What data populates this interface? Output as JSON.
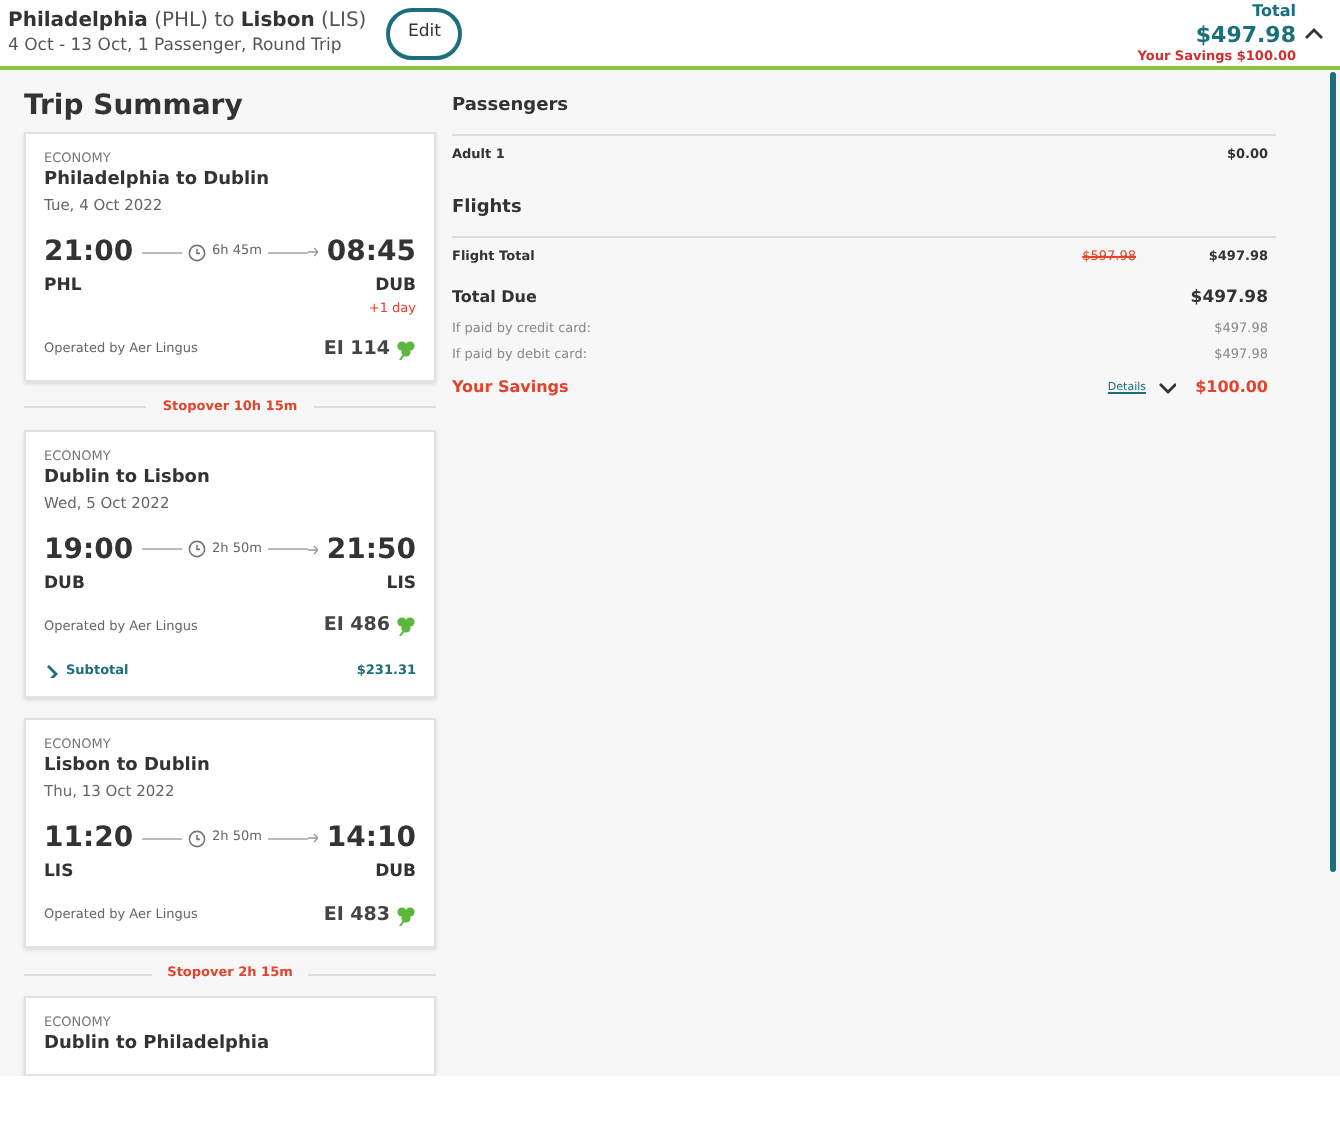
{
  "header": {
    "origin": "Philadelphia",
    "origin_code": "(PHL)",
    "connector": "to",
    "destination": "Lisbon",
    "destination_code": "(LIS)",
    "details": "4 Oct - 13 Oct, 1 Passenger, Round Trip",
    "edit_button": "Edit",
    "total_label": "Total",
    "total": "$497.98",
    "savings": "Your Savings $100.00",
    "expanded": true
  },
  "trip_summary": {
    "title": "Trip Summary",
    "items": [
      {
        "kind": "segment",
        "cabin": "ECONOMY",
        "route": "Philadelphia to Dublin",
        "date": "Tue, 4 Oct 2022",
        "depart_time": "21:00",
        "duration": "6h 45m",
        "arrive_time": "08:45",
        "depart_code": "PHL",
        "arrive_code": "DUB",
        "day_offset": "+1 day",
        "operator": "Operated by Aer Lingus",
        "flight": "EI 114"
      },
      {
        "kind": "stopover",
        "label": "Stopover 10h 15m"
      },
      {
        "kind": "segment",
        "cabin": "ECONOMY",
        "route": "Dublin to Lisbon",
        "date": "Wed, 5 Oct 2022",
        "depart_time": "19:00",
        "duration": "2h 50m",
        "arrive_time": "21:50",
        "depart_code": "DUB",
        "arrive_code": "LIS",
        "operator": "Operated by Aer Lingus",
        "flight": "EI 486",
        "subtotal": {
          "label": "Subtotal",
          "amount": "$231.31",
          "expanded": false
        }
      },
      {
        "kind": "segment",
        "cabin": "ECONOMY",
        "route": "Lisbon to Dublin",
        "date": "Thu, 13 Oct 2022",
        "depart_time": "11:20",
        "duration": "2h 50m",
        "arrive_time": "14:10",
        "depart_code": "LIS",
        "arrive_code": "DUB",
        "operator": "Operated by Aer Lingus",
        "flight": "EI 483"
      },
      {
        "kind": "stopover",
        "label": "Stopover 2h 15m"
      },
      {
        "kind": "segment",
        "cabin": "ECONOMY",
        "route": "Dublin to Philadelphia"
      }
    ]
  },
  "price_summary": {
    "passengers": {
      "title": "Passengers",
      "rows": [
        {
          "label": "Adult 1",
          "amount": "$0.00"
        }
      ]
    },
    "flights": {
      "title": "Flights",
      "flight_total_label": "Flight Total",
      "original_price": "$597.98",
      "flight_total": "$497.98"
    },
    "total_due_label": "Total Due",
    "total_due": "$497.98",
    "payment_rows": [
      {
        "label": "If paid by credit card:",
        "amount": "$497.98"
      },
      {
        "label": "If paid by debit card:",
        "amount": "$497.98"
      }
    ],
    "savings": {
      "label": "Your Savings",
      "details_link": "Details",
      "expanded": false,
      "amount": "$100.00"
    }
  }
}
